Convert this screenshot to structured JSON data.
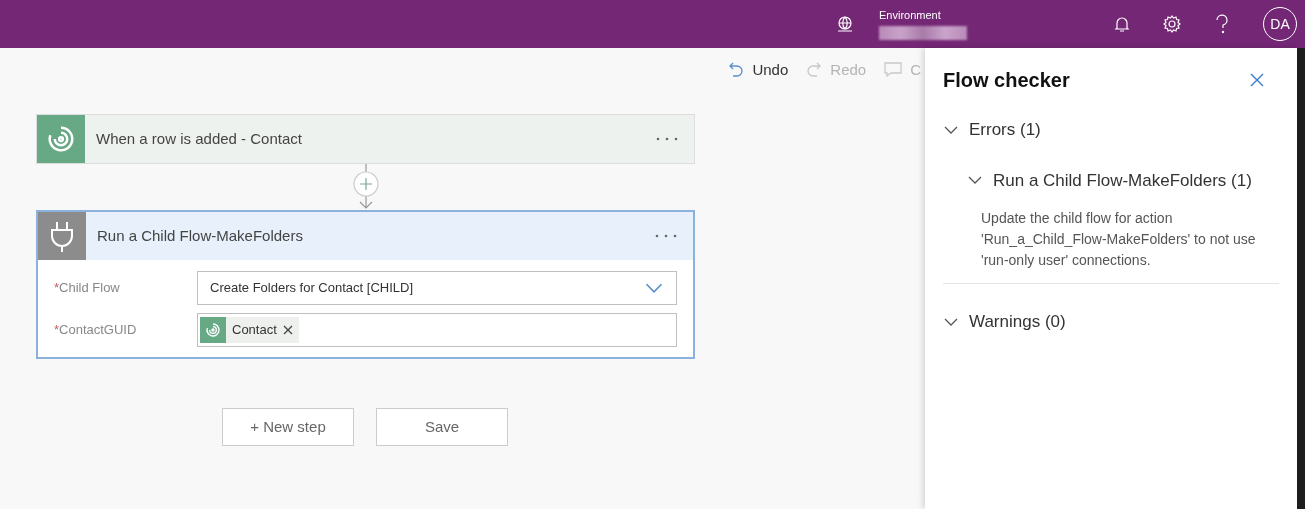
{
  "header": {
    "environment_label": "Environment",
    "avatar": "DA"
  },
  "toolbar": [
    {
      "label": "Undo",
      "disabled": false,
      "kind": "undo"
    },
    {
      "label": "Redo",
      "disabled": true,
      "kind": "redo"
    },
    {
      "label": "C",
      "disabled": true,
      "kind": "comment"
    }
  ],
  "steps": [
    {
      "kind": "trigger",
      "title": "When a row is added - Contact"
    },
    {
      "kind": "action",
      "title": "Run a Child Flow-MakeFolders",
      "fields": [
        {
          "label": "Child Flow",
          "required_mark": "*",
          "kind": "dropdown",
          "value": "Create Folders for Contact [CHILD]"
        },
        {
          "label": "ContactGUID",
          "required_mark": "*",
          "kind": "tokens",
          "tokens": [
            "Contact"
          ]
        }
      ]
    }
  ],
  "buttons": [
    "+ New step",
    "Save"
  ],
  "flow_checker": {
    "title": "Flow checker",
    "sections": [
      {
        "label": "Errors (1)",
        "expanded": true,
        "children": [
          {
            "label": "Run a Child Flow-MakeFolders (1)",
            "expanded": true,
            "message": "Update the child flow for action 'Run_a_Child_Flow-MakeFolders' to not use 'run-only user' connections."
          }
        ]
      },
      {
        "label": "Warnings (0)",
        "expanded": true
      }
    ]
  }
}
